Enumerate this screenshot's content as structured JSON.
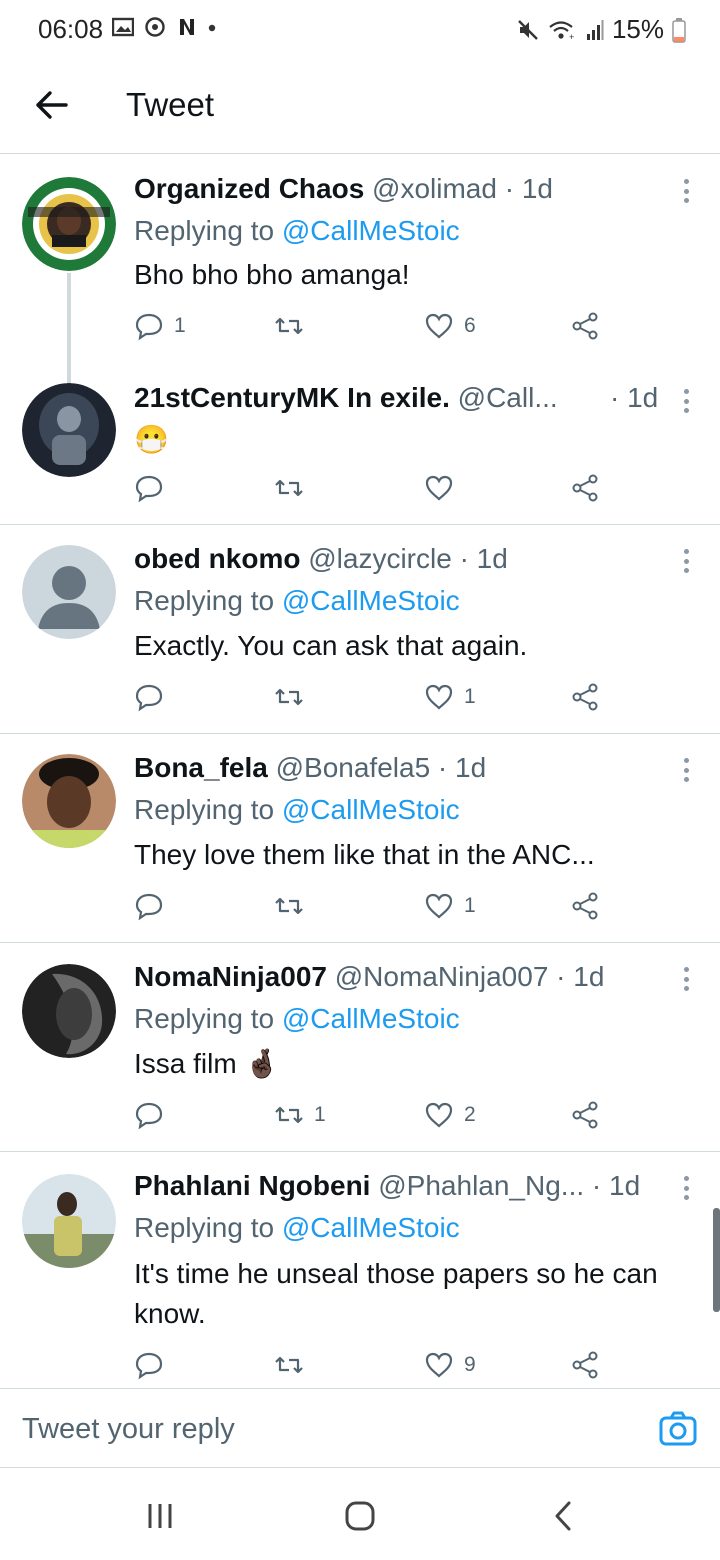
{
  "status_bar": {
    "time": "06:08",
    "battery": "15%",
    "left_icons": [
      "gallery-icon",
      "whatsapp-icon",
      "netflix-icon",
      "dot-icon"
    ],
    "right_icons": [
      "mute-icon",
      "wifi-icon",
      "signal-icon",
      "battery-icon"
    ]
  },
  "header": {
    "title": "Tweet",
    "back_icon": "arrow-left-icon"
  },
  "tweets": [
    {
      "name": "Organized Chaos",
      "handle": "@xolimad · 1d",
      "replying_prefix": "Replying to ",
      "replying_to": "@CallMeStoic",
      "text": "Bho bho bho amanga!",
      "counts": {
        "reply": "1",
        "retweet": "",
        "like": "6"
      }
    },
    {
      "name": "21stCenturyMK In exile.",
      "handle": "@Call...",
      "time": "· 1d",
      "text": "😷",
      "counts": {
        "reply": "",
        "retweet": "",
        "like": ""
      }
    },
    {
      "name": "obed nkomo",
      "handle": "@lazycircle · 1d",
      "replying_prefix": "Replying to ",
      "replying_to": "@CallMeStoic",
      "text": "Exactly. You can ask that again.",
      "counts": {
        "reply": "",
        "retweet": "",
        "like": "1"
      }
    },
    {
      "name": "Bona_fela",
      "handle": "@Bonafela5 · 1d",
      "replying_prefix": "Replying to ",
      "replying_to": "@CallMeStoic",
      "text": "They love them like that in the ANC...",
      "counts": {
        "reply": "",
        "retweet": "",
        "like": "1"
      }
    },
    {
      "name": "NomaNinja007",
      "handle": "@NomaNinja007 · 1d",
      "replying_prefix": "Replying to ",
      "replying_to": "@CallMeStoic",
      "text": "Issa film 🤞🏿",
      "counts": {
        "reply": "",
        "retweet": "1",
        "like": "2"
      }
    },
    {
      "name": "Phahlani Ngobeni",
      "handle": "@Phahlan_Ng... · 1d",
      "replying_prefix": "Replying to ",
      "replying_to": "@CallMeStoic",
      "text": "It's time he unseal those papers so he can know.",
      "counts": {
        "reply": "",
        "retweet": "",
        "like": "9"
      }
    }
  ],
  "reply_bar": {
    "placeholder": "Tweet your reply",
    "camera_icon": "camera-icon"
  },
  "nav_bar": {
    "icons": [
      "recent-apps-icon",
      "home-icon",
      "back-icon"
    ]
  },
  "colors": {
    "accent": "#1d9bf0",
    "text": "#0f1419",
    "secondary": "#536471",
    "divider": "#cfd9de"
  }
}
